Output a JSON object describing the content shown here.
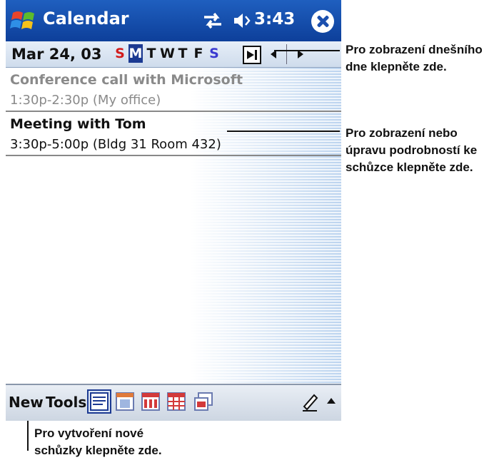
{
  "titlebar": {
    "app_title": "Calendar",
    "time": "3:43",
    "start_icon": "windows-flag-icon",
    "connectivity_icon": "connectivity-icon",
    "volume_icon": "speaker-icon",
    "close_icon": "close-icon"
  },
  "datebar": {
    "date": "Mar 24, 03",
    "days": [
      "S",
      "M",
      "T",
      "W",
      "T",
      "F",
      "S"
    ],
    "selected_day_index": 1,
    "goto_today_icon": "goto-today-icon",
    "prev_icon": "arrow-left-icon",
    "next_icon": "arrow-right-icon"
  },
  "appointments": [
    {
      "title": "Conference call with Microsoft",
      "time": "1:30p-2:30p  (My office)",
      "state": "past"
    },
    {
      "title": "Meeting with Tom",
      "time": "3:30p-5:00p  (Bldg 31 Room 432)",
      "state": "upcoming"
    }
  ],
  "bottombar": {
    "new_label": "New",
    "tools_label": "Tools",
    "view_icons": [
      "agenda-view-icon",
      "day-view-icon",
      "week-view-icon",
      "month-view-icon",
      "year-view-icon"
    ],
    "pen_icon": "pen-icon",
    "sip_icon": "input-panel-arrow-icon"
  },
  "callouts": {
    "today": [
      "Pro zobrazení dnešního",
      "dne klepněte zde."
    ],
    "details": [
      "Pro zobrazení nebo",
      "úpravu podrobností ke",
      "schůzce klepněte zde."
    ],
    "new": [
      "Pro vytvoření nové",
      "schůzky klepněte zde."
    ]
  },
  "colors": {
    "titlebar": "#1f5fbf",
    "selected_day": "#1c3a92",
    "sunday": "#d21c1c",
    "saturday": "#3a3ad0"
  }
}
